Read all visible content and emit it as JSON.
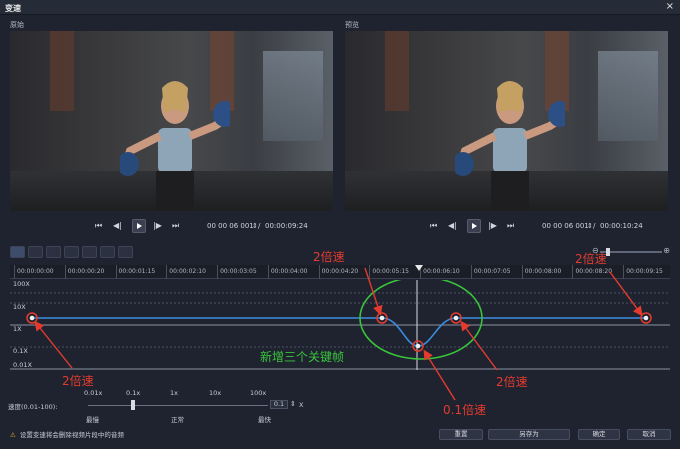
{
  "window": {
    "title": "变速",
    "close": "×"
  },
  "panels": {
    "left_label": "原始",
    "right_label": "预览"
  },
  "player_left": {
    "timecode": "00 00 06 001",
    "sep": "/",
    "duration": "00:00:09:24"
  },
  "player_right": {
    "timecode": "00 00 06 001",
    "sep": "/",
    "duration": "00:00:10:24"
  },
  "ruler": {
    "labels": [
      "00:00:00:00",
      "00:00:00:20",
      "00:00:01:15",
      "00:00:02:10",
      "00:00:03:05",
      "00:00:04:00",
      "00:00:04:20",
      "00:00:05:15",
      "00:00:06:10",
      "00:00:07:05",
      "00:00:08:00",
      "00:00:08:20",
      "00:00:09:15"
    ]
  },
  "graph": {
    "y_labels": [
      "100X",
      "10X",
      "1X",
      "0.1X",
      "0.01X"
    ]
  },
  "speed": {
    "scale_labels": [
      "0.01x",
      "0.1x",
      "1x",
      "10x",
      "100x"
    ],
    "caption": "速度(0.01-100):",
    "value": "0.1",
    "unit": "X",
    "slow_label": "最慢",
    "normal_label": "正常",
    "fast_label": "最快",
    "slider_fraction": 0.25
  },
  "footer": {
    "warning": "设置变速将会删除视频片段中的音频",
    "buttons": {
      "reset": "重置",
      "save_as": "另存为",
      "ok": "确定",
      "cancel": "取消"
    }
  },
  "annotations": {
    "top_mid": "2倍速",
    "top_right": "2倍速",
    "bottom_left": "2倍速",
    "bottom_right": "2倍速",
    "bottom_center": "0.1倍速",
    "new_keyframes": "新增三个关键帧"
  },
  "colors": {
    "curve": "#3b8de0",
    "annotation_red": "#e43b2e",
    "annotation_green": "#39c43a"
  }
}
